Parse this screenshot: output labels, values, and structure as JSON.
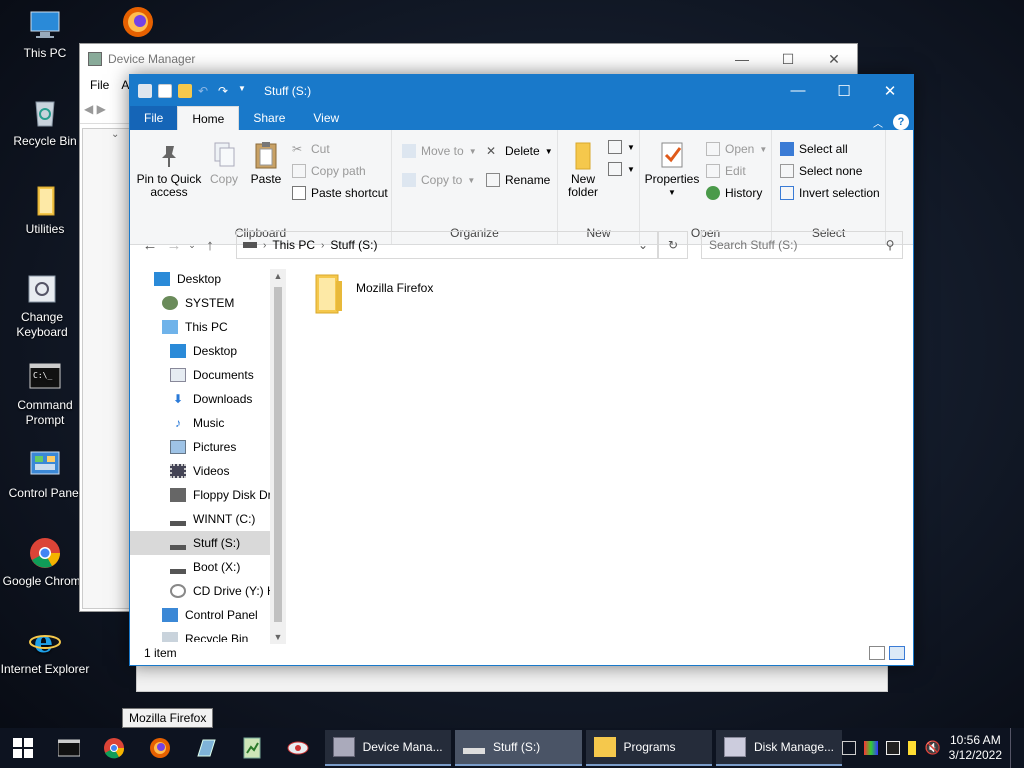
{
  "desktop": {
    "icons": [
      {
        "label": "This PC"
      },
      {
        "label": ""
      },
      {
        "label": "Recycle Bin"
      },
      {
        "label": "Utilities"
      },
      {
        "label": "Change Keyboard Layout"
      },
      {
        "label": "Command Prompt"
      },
      {
        "label": "Control Panel"
      },
      {
        "label": "Google Chrome"
      },
      {
        "label": "Internet Explorer"
      }
    ]
  },
  "device_manager": {
    "title": "Device Manager",
    "menu": [
      "File",
      "A"
    ]
  },
  "explorer": {
    "title": "Stuff (S:)",
    "tabs": {
      "file": "File",
      "home": "Home",
      "share": "Share",
      "view": "View"
    },
    "ribbon": {
      "clipboard": {
        "label": "Clipboard",
        "pin": "Pin to Quick access",
        "copy": "Copy",
        "paste": "Paste",
        "cut": "Cut",
        "copy_path": "Copy path",
        "paste_shortcut": "Paste shortcut"
      },
      "organize": {
        "label": "Organize",
        "move_to": "Move to",
        "copy_to": "Copy to",
        "delete": "Delete",
        "rename": "Rename"
      },
      "new": {
        "label": "New",
        "new_folder": "New folder"
      },
      "open": {
        "label": "Open",
        "properties": "Properties",
        "open": "Open",
        "edit": "Edit",
        "history": "History"
      },
      "select": {
        "label": "Select",
        "select_all": "Select all",
        "select_none": "Select none",
        "invert": "Invert selection"
      }
    },
    "address": {
      "crumbs": [
        "This PC",
        "Stuff (S:)"
      ]
    },
    "search": {
      "placeholder": "Search Stuff (S:)"
    },
    "nav": [
      {
        "label": "Desktop",
        "indent": 0
      },
      {
        "label": "SYSTEM",
        "indent": 1
      },
      {
        "label": "This PC",
        "indent": 1
      },
      {
        "label": "Desktop",
        "indent": 2
      },
      {
        "label": "Documents",
        "indent": 2
      },
      {
        "label": "Downloads",
        "indent": 2
      },
      {
        "label": "Music",
        "indent": 2
      },
      {
        "label": "Pictures",
        "indent": 2
      },
      {
        "label": "Videos",
        "indent": 2
      },
      {
        "label": "Floppy Disk Dri",
        "indent": 2
      },
      {
        "label": "WINNT (C:)",
        "indent": 2
      },
      {
        "label": "Stuff (S:)",
        "indent": 2
      },
      {
        "label": "Boot (X:)",
        "indent": 2
      },
      {
        "label": "CD Drive (Y:) H",
        "indent": 2
      },
      {
        "label": "Control Panel",
        "indent": 1
      },
      {
        "label": "Recycle Bin",
        "indent": 1
      }
    ],
    "files": [
      {
        "name": "Mozilla Firefox"
      }
    ],
    "status": "1 item"
  },
  "tooltip": "Mozilla Firefox",
  "taskbar": {
    "tasks": [
      {
        "label": "Device Mana..."
      },
      {
        "label": "Stuff (S:)"
      },
      {
        "label": "Programs"
      },
      {
        "label": "Disk Manage..."
      }
    ],
    "clock": {
      "time": "10:56 AM",
      "date": "3/12/2022"
    }
  },
  "colors": {
    "accent": "#1979ca",
    "folder": "#f5c84c",
    "taskbar": "#0d1320"
  }
}
